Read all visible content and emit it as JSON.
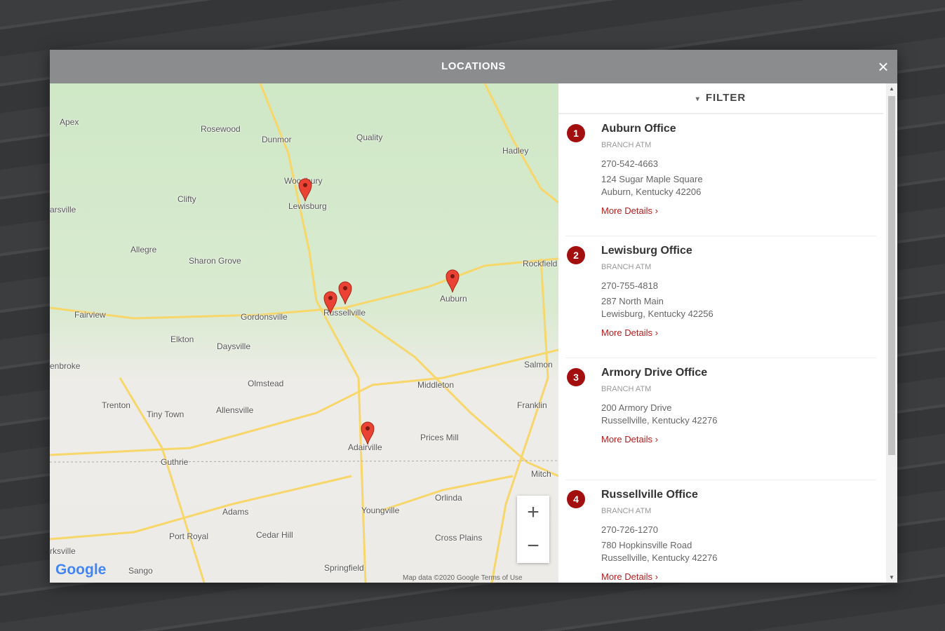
{
  "modal": {
    "title": "LOCATIONS",
    "close_icon": "×"
  },
  "map": {
    "labels": [
      "Apex",
      "Rosewood",
      "Dunmor",
      "Quality",
      "Hadley",
      "Woodbury",
      "Lewisburg",
      "Clifty",
      "Allegre",
      "Sharon Grove",
      "Rockfield",
      "Auburn",
      "Russellville",
      "Gordonsville",
      "Fairview",
      "Elkton",
      "Daysville",
      "Salmon",
      "Olmstead",
      "Middleton",
      "Trenton",
      "Tiny Town",
      "Allensville",
      "Franklin",
      "Prices Mill",
      "Adairville",
      "Guthrie",
      "Orlinda",
      "Adams",
      "Youngville",
      "Port Royal",
      "Cedar Hill",
      "Cross Plains",
      "Springfield",
      "Sango",
      "rksville",
      "enbroke",
      "arsville",
      "Mitch"
    ],
    "zoom_in": "+",
    "zoom_out": "−",
    "logo": "Google",
    "attribution": "Map data ©2020 Google    Terms of Use"
  },
  "sidebar": {
    "filter_label": "FILTER",
    "filter_icon": "▾",
    "more_label": "More Details",
    "more_icon": "›",
    "locations": [
      {
        "num": "1",
        "name": "Auburn Office",
        "type": "BRANCH  ATM",
        "phone": "270-542-4663",
        "addr1": "124 Sugar Maple Square",
        "addr2": "Auburn, Kentucky 42206"
      },
      {
        "num": "2",
        "name": "Lewisburg Office",
        "type": "BRANCH  ATM",
        "phone": "270-755-4818",
        "addr1": "287 North Main",
        "addr2": "Lewisburg, Kentucky 42256"
      },
      {
        "num": "3",
        "name": "Armory Drive Office",
        "type": "BRANCH  ATM",
        "addr1": "200 Armory Drive",
        "addr2": "Russellville, Kentucky 42276"
      },
      {
        "num": "4",
        "name": "Russellville Office",
        "type": "BRANCH  ATM",
        "phone": "270-726-1270",
        "addr1": "780 Hopkinsville Road",
        "addr2": "Russellville, Kentucky 42276"
      }
    ]
  },
  "colors": {
    "accent": "#a30f0f",
    "header": "#8b8c8e",
    "link": "#b32020"
  }
}
